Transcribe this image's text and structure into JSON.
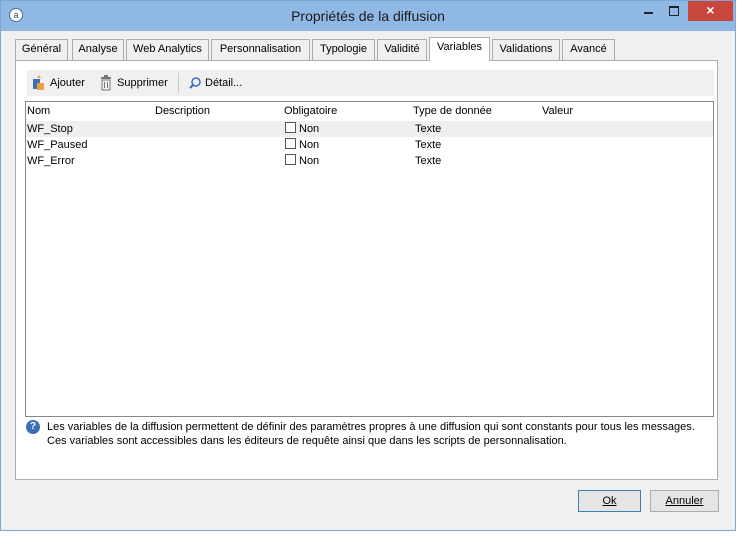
{
  "window": {
    "title": "Propriétés de la diffusion",
    "controls": {
      "minimize": "—",
      "maximize": "□",
      "close": "×"
    }
  },
  "tabs": [
    {
      "label": "Général",
      "active": false
    },
    {
      "label": "Analyse",
      "active": false
    },
    {
      "label": "Web Analytics",
      "active": false
    },
    {
      "label": "Personnalisation",
      "active": false
    },
    {
      "label": "Typologie",
      "active": false
    },
    {
      "label": "Validité",
      "active": false
    },
    {
      "label": "Variables",
      "active": true
    },
    {
      "label": "Validations",
      "active": false
    },
    {
      "label": "Avancé",
      "active": false
    }
  ],
  "toolbar": {
    "add_label": "Ajouter",
    "delete_label": "Supprimer",
    "detail_label": "Détail..."
  },
  "table": {
    "columns": [
      "Nom",
      "Description",
      "Obligatoire",
      "Type de donnée",
      "Valeur"
    ],
    "rows": [
      {
        "name": "WF_Stop",
        "description": "",
        "mandatory": "Non",
        "type": "Texte",
        "value": "",
        "selected": true
      },
      {
        "name": "WF_Paused",
        "description": "",
        "mandatory": "Non",
        "type": "Texte",
        "value": "",
        "selected": false
      },
      {
        "name": "WF_Error",
        "description": "",
        "mandatory": "Non",
        "type": "Texte",
        "value": "",
        "selected": false
      }
    ]
  },
  "help": {
    "line1": "Les variables de la diffusion permettent de définir des paramètres propres à une diffusion qui sont constants pour tous les messages.",
    "line2": "Ces variables sont accessibles dans les éditeurs de requête ainsi que dans les scripts de personnalisation."
  },
  "buttons": {
    "ok_label": "Ok",
    "cancel_label": "Annuler"
  },
  "colors": {
    "titlebar": "#8fb8e5",
    "close_button": "#c9463d",
    "help_icon": "#3c6fb6"
  }
}
